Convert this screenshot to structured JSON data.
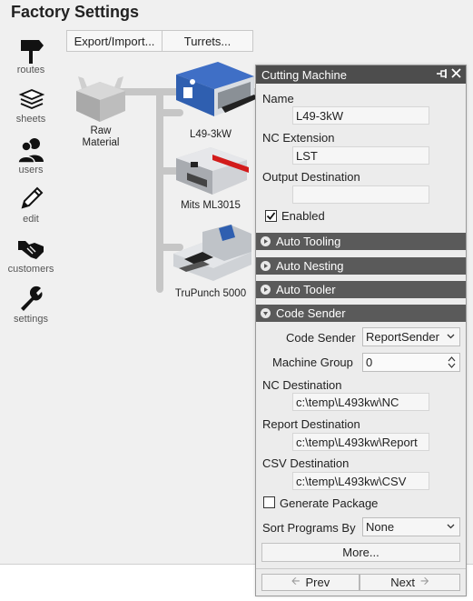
{
  "app": {
    "title": "Factory Settings"
  },
  "toolbar": {
    "export_label": "Export/Import...",
    "turrets_label": "Turrets..."
  },
  "rail": {
    "items": [
      {
        "label": "routes",
        "icon": "signpost-icon"
      },
      {
        "label": "sheets",
        "icon": "sheets-icon"
      },
      {
        "label": "users",
        "icon": "users-icon"
      },
      {
        "label": "edit",
        "icon": "pencil-icon"
      },
      {
        "label": "customers",
        "icon": "handshake-icon"
      },
      {
        "label": "settings",
        "icon": "wrench-icon"
      }
    ]
  },
  "canvas": {
    "nodes": [
      {
        "label": "Raw\nMaterial",
        "label_line1": "Raw",
        "label_line2": "Material"
      },
      {
        "label": "L49-3kW"
      },
      {
        "label": "Mits ML3015"
      },
      {
        "label": "TruPunch 5000"
      }
    ]
  },
  "panel": {
    "title": "Cutting Machine",
    "name_label": "Name",
    "name_value": "L49-3kW",
    "nc_ext_label": "NC Extension",
    "nc_ext_value": "LST",
    "output_dest_label": "Output Destination",
    "output_dest_value": "",
    "enabled_label": "Enabled",
    "enabled_checked": true,
    "sections": {
      "auto_tooling": "Auto Tooling",
      "auto_nesting": "Auto Nesting",
      "auto_tooler": "Auto Tooler",
      "code_sender": "Code Sender"
    },
    "code_sender": {
      "code_sender_label": "Code Sender",
      "code_sender_value": "ReportSender",
      "machine_group_label": "Machine Group",
      "machine_group_value": "0",
      "nc_dest_label": "NC Destination",
      "nc_dest_value": "c:\\temp\\L493kw\\NC",
      "report_dest_label": "Report Destination",
      "report_dest_value": "c:\\temp\\L493kw\\Report",
      "csv_dest_label": "CSV Destination",
      "csv_dest_value": "c:\\temp\\L493kw\\CSV",
      "generate_package_label": "Generate Package",
      "generate_package_checked": false,
      "sort_programs_label": "Sort Programs By",
      "sort_programs_value": "None",
      "more_label": "More..."
    },
    "prev_label": "Prev",
    "next_label": "Next"
  }
}
